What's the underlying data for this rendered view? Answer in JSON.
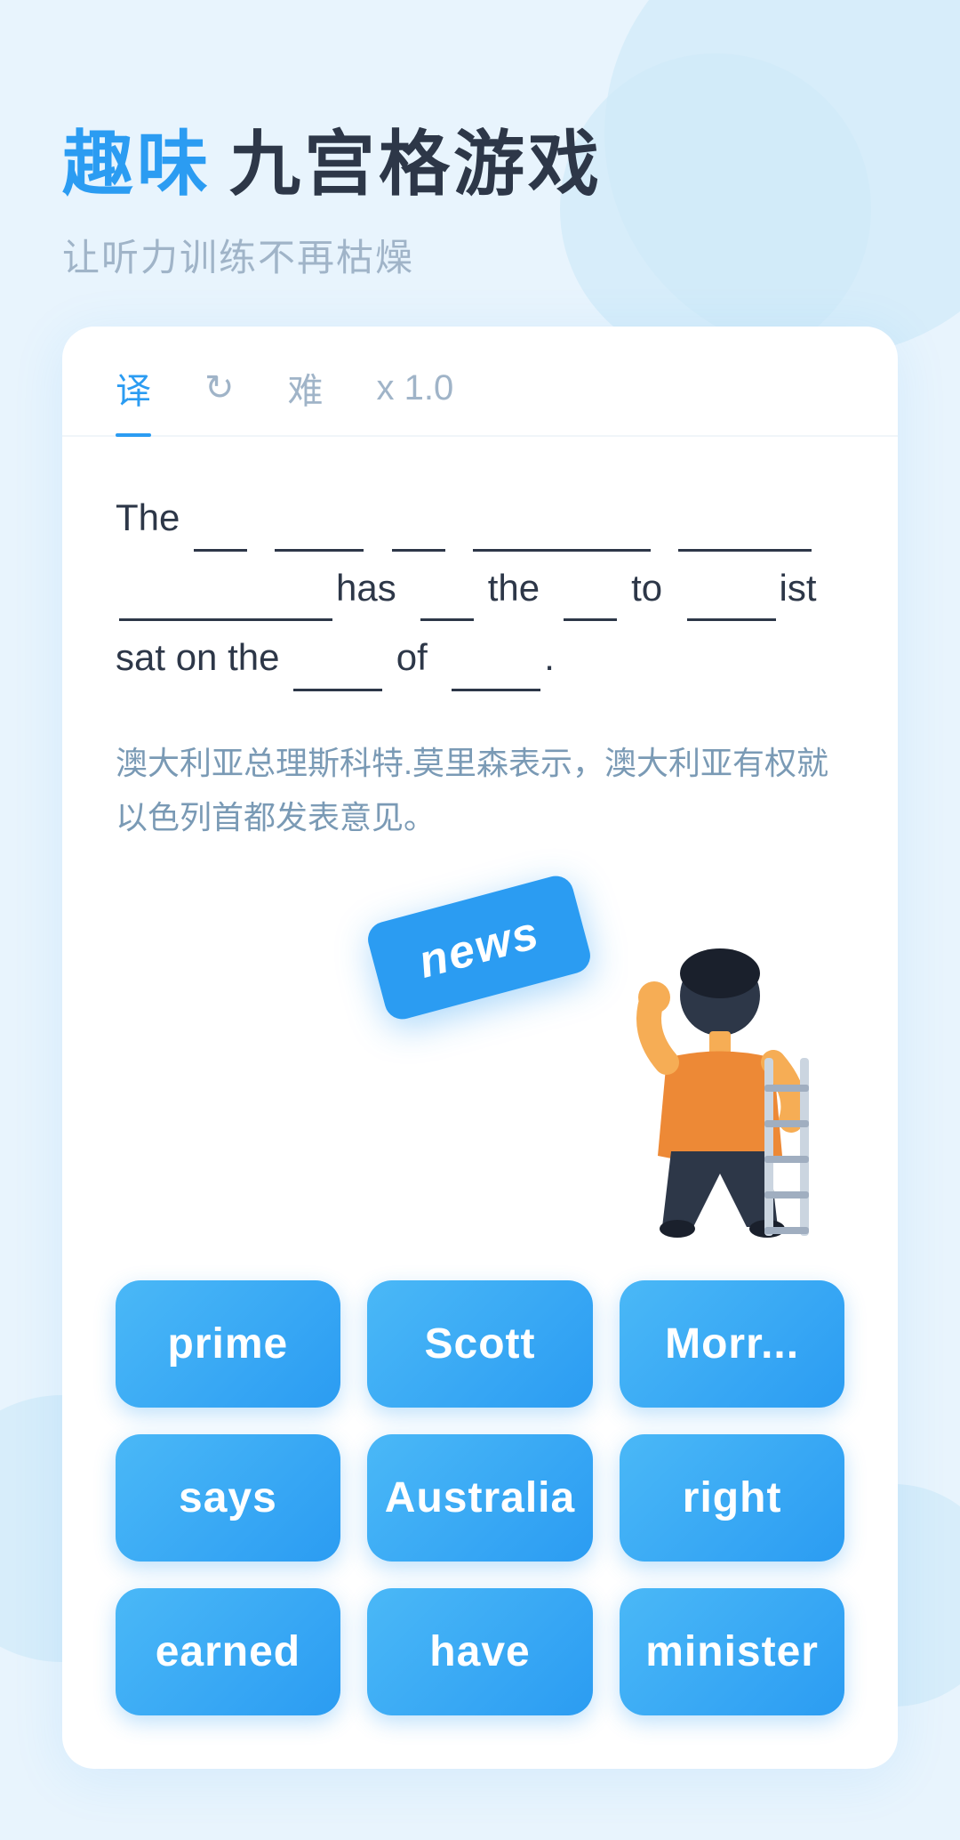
{
  "header": {
    "title_blue": "趣味",
    "title_dark": "九宫格游戏",
    "subtitle": "让听力训练不再枯燥"
  },
  "tabs": [
    {
      "label": "译",
      "active": true
    },
    {
      "label": "↻",
      "active": false,
      "icon": true
    },
    {
      "label": "难",
      "active": false
    },
    {
      "label": "x 1.0",
      "active": false
    }
  ],
  "sentence": {
    "line1": "The ___ ______ ___ __________ _____",
    "line2": "________has ___ the ___ to _____ist",
    "line3": "sat on the ____ of _____.",
    "display_parts": [
      "The",
      " ___ ",
      " ______ ",
      " ___ ",
      " __________ ",
      " _____",
      " ________ ",
      "has",
      " ___ ",
      "the",
      " ___ ",
      "to",
      " _____ ",
      "ist",
      "sat on the",
      " ____ ",
      "of",
      " _____ ",
      "."
    ]
  },
  "translation": "澳大利亚总理斯科特.莫里森表示，澳大利亚有权就以色列首都发表意见。",
  "news_card": {
    "label": "news"
  },
  "word_buttons": [
    {
      "id": "prime",
      "label": "prime"
    },
    {
      "id": "scott",
      "label": "Scott"
    },
    {
      "id": "morrison",
      "label": "Morr..."
    },
    {
      "id": "says",
      "label": "says"
    },
    {
      "id": "australia",
      "label": "Australia"
    },
    {
      "id": "right",
      "label": "right"
    },
    {
      "id": "earned",
      "label": "earned"
    },
    {
      "id": "have",
      "label": "have"
    },
    {
      "id": "minister",
      "label": "minister"
    }
  ]
}
